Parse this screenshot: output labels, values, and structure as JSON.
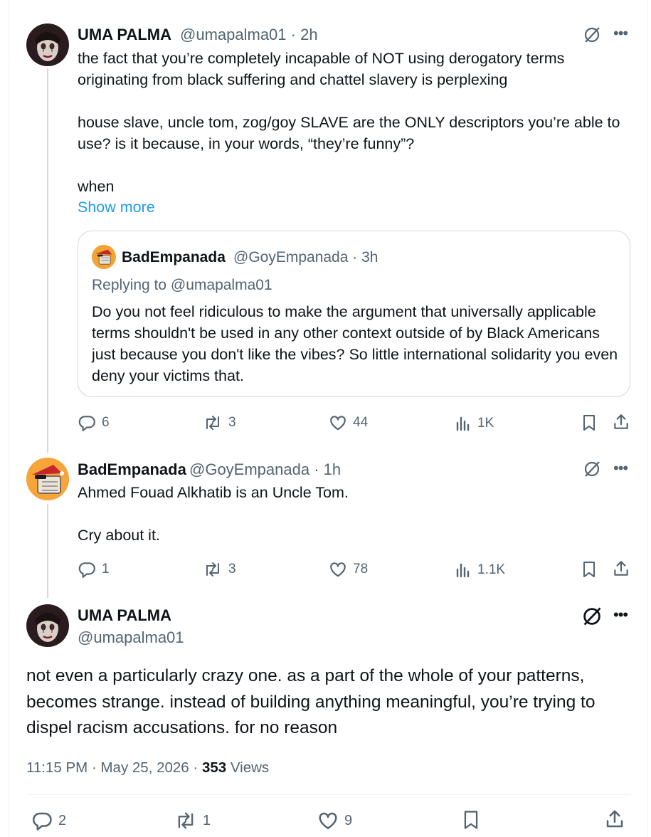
{
  "tweets": [
    {
      "name": "UMA PALMA",
      "handle": "@umapalma01",
      "time": "2h",
      "text": "the fact that you’re completely incapable of NOT using derogatory terms originating from black suffering and chattel slavery is perplexing\n\nhouse slave, uncle tom, zog/goy SLAVE are the ONLY descriptors you’re able to use? is it because, in your words, “they’re funny”?\n\nwhen",
      "show_more": "Show more",
      "quote": {
        "name": "BadEmpanada",
        "handle": "@GoyEmpanada",
        "time": "3h",
        "replying_to": "Replying to @umapalma01",
        "text": "Do you not feel ridiculous to make the argument that universally applicable terms shouldn't be used in any other context outside of by Black Americans just because you don't like the vibes? So little international solidarity you even deny your victims that."
      },
      "stats": {
        "replies": "6",
        "reposts": "3",
        "likes": "44",
        "views": "1K"
      }
    },
    {
      "name": "BadEmpanada",
      "handle": "@GoyEmpanada",
      "time": "1h",
      "text": "Ahmed Fouad Alkhatib is an Uncle Tom.\n\nCry about it.",
      "stats": {
        "replies": "1",
        "reposts": "3",
        "likes": "78",
        "views": "1.1K"
      }
    }
  ],
  "main": {
    "name": "UMA PALMA",
    "handle": "@umapalma01",
    "text": "not even a particularly crazy one. as a part of the whole of your patterns, becomes strange. instead of building anything meaningful, you’re trying to dispel racism accusations. for no reason",
    "time": "11:15 PM",
    "date": "May 25, 2026",
    "views_count": "353",
    "views_label": "Views",
    "stats": {
      "replies": "2",
      "reposts": "1",
      "likes": "9"
    }
  },
  "separator": "·",
  "colors": {
    "text": "#0f1419",
    "secondary": "#536471",
    "link": "#1d9bf0",
    "border": "#cfd9de"
  },
  "icons": [
    "grok-icon",
    "more-icon",
    "reply-icon",
    "repost-icon",
    "like-icon",
    "views-icon",
    "bookmark-icon",
    "share-icon"
  ]
}
